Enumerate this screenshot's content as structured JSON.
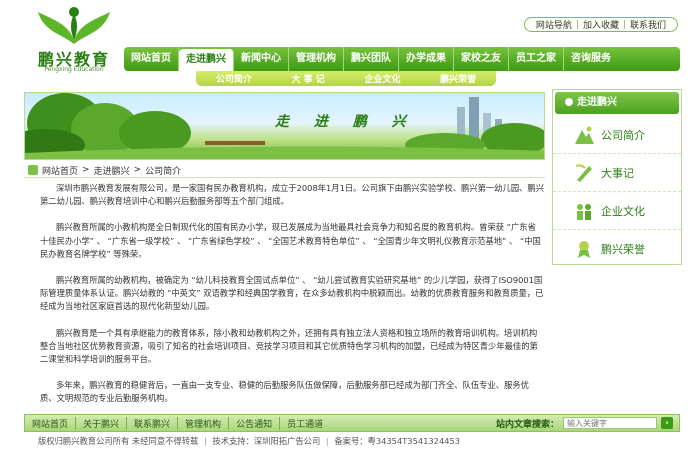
{
  "logo": {
    "name_cn": "鹏兴教育",
    "name_en": "Pengxing Education"
  },
  "top_links": [
    "网站导航",
    "加入收藏",
    "联系我们"
  ],
  "nav": [
    "网站首页",
    "走进鹏兴",
    "新闻中心",
    "管理机构",
    "鹏兴团队",
    "办学成果",
    "家校之友",
    "员工之家",
    "咨询服务"
  ],
  "nav_active": "走进鹏兴",
  "subnav": [
    "公司简介",
    "大 事 记",
    "企业文化",
    "鹏兴荣誉"
  ],
  "banner": {
    "title": "走 进 鹏 兴"
  },
  "breadcrumb": [
    "网站首页",
    "走进鹏兴",
    "公司简介"
  ],
  "content": [
    "深圳市鹏兴教育发展有限公司，是一家国有民办教育机构，成立于2008年1月1日。公司旗下由鹏兴实验学校、鹏兴第一幼儿园、鹏兴第二幼儿园、鹏兴教育培训中心和鹏兴后勤服务部等五个部门组成。",
    "鹏兴教育所属的小教机构是全日制现代化的国有民办小学，现已发展成为当地最具社会竞争力和知名度的教育机构。曾荣获 “广东省十佳民办小学” 、 “广东省一级学校” 、 “广东省绿色学校” 、 “全国艺术教育特色单位” 、 “全国青少年文明礼仪教育示范基地” 、 “中国民办教育名牌学校” 等殊荣。",
    "鹏兴教育所属的幼教机构，被确定为 “幼儿科技教育全国试点单位” 、 “幼儿尝试教育实验研究基地” 的少儿学园，获得了ISO9001国际管理质量体系认证。鹏兴幼教的 “中英文” 双语教学和经典国学教育，在众多幼教机构中脱颖而出。幼教的优质教育服务和教育质量，已经成为当地社区家庭首选的现代化新型幼儿园。",
    "鹏兴教育是一个具有承继能力的教育体系，除小教和幼教机构之外，还拥有具有独立法人资格和独立场所的教育培训机构。培训机构整合当地社区优势教育资源，吸引了知名的社会培训项目、竞技学习项目和其它优质特色学习机构的加盟，已经成为特区青少年最佳的第二课堂和科学培训的服务平台。",
    "多年来，鹏兴教育的稳健背后，一直由一支专业、稳健的后勤服务队伍做保障，后勤服务部已经成为部门齐全、队伍专业、服务优质、文明规范的专业后勤服务机构。"
  ],
  "sidebar": {
    "title": "走进鹏兴",
    "items": [
      {
        "label": "公司简介",
        "icon": "mountain-icon"
      },
      {
        "label": "大事记",
        "icon": "pen-icon"
      },
      {
        "label": "企业文化",
        "icon": "people-icon"
      },
      {
        "label": "鹏兴荣誉",
        "icon": "award-icon"
      }
    ]
  },
  "footer_nav": [
    "网站首页",
    "关于鹏兴",
    "联系鹏兴",
    "管理机构",
    "公告通知",
    "员工通道"
  ],
  "search": {
    "label": "站内文章搜索：",
    "placeholder": "输入关键字"
  },
  "copyright": [
    "版权归鹏兴教育公司所有",
    "未经同意不得转载",
    "技术支持：深圳阳拓广告公司",
    "备案号：粤34354T3541324453"
  ],
  "colors": {
    "brand_green": "#3d9b12",
    "accent_lime": "#b3d44a"
  }
}
